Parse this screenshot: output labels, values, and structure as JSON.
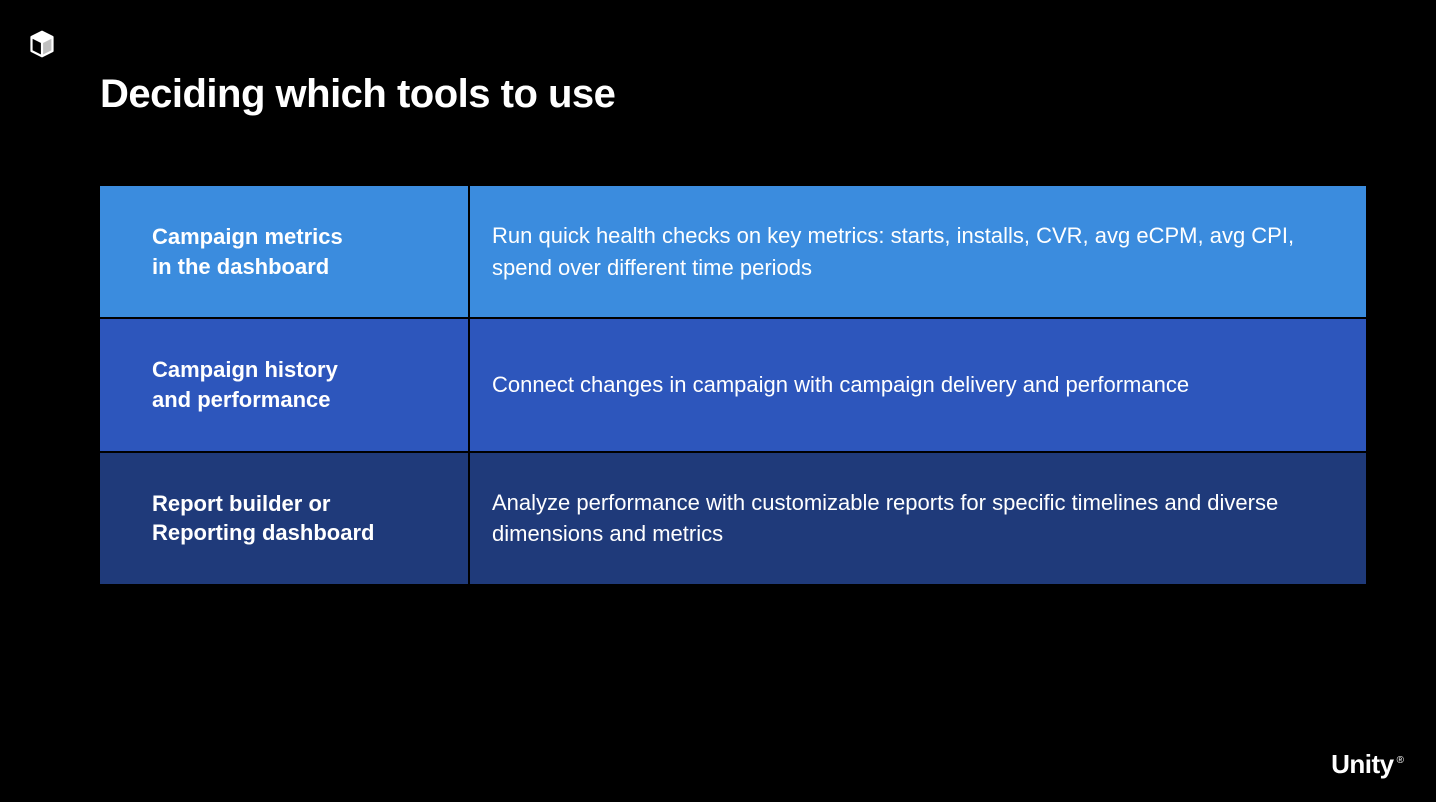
{
  "title": "Deciding which tools to use",
  "rows": [
    {
      "label": "Campaign metrics\nin the dashboard",
      "description": "Run quick health checks on key metrics: starts, installs, CVR, avg eCPM, avg CPI, spend over different time periods"
    },
    {
      "label": "Campaign history\nand performance",
      "description": "Connect changes in campaign with campaign delivery and performance"
    },
    {
      "label": "Report builder or\nReporting dashboard",
      "description": "Analyze performance with customizable reports for specific timelines and diverse dimensions and metrics"
    }
  ],
  "brand": {
    "name": "Unity",
    "reg": "®"
  }
}
